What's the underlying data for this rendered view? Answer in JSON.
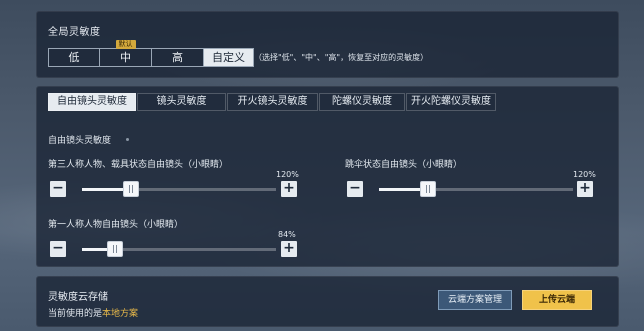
{
  "global": {
    "title": "全局灵敏度",
    "options": [
      "低",
      "中",
      "高",
      "自定义"
    ],
    "default_badge": "默认",
    "selected": "自定义",
    "hint": "（选择\"低\"、\"中\"、\"高\"，恢复至对应的灵敏度）"
  },
  "tabs": [
    "自由镜头灵敏度",
    "镜头灵敏度",
    "开火镜头灵敏度",
    "陀螺仪灵敏度",
    "开火陀螺仪灵敏度"
  ],
  "selected_tab": "自由镜头灵敏度",
  "section": {
    "title": "自由镜头灵敏度"
  },
  "sliders": [
    {
      "label": "第三人称人物、载具状态自由镜头（小眼睛）",
      "value_text": "120%",
      "level": 0.25
    },
    {
      "label": "跳伞状态自由镜头（小眼睛）",
      "value_text": "120%",
      "level": 0.25
    },
    {
      "label": "第一人称人物自由镜头（小眼睛）",
      "value_text": "84%",
      "level": 0.17
    }
  ],
  "cloud": {
    "title": "灵敏度云存储",
    "current_prefix": "当前使用的是",
    "current_value": "本地方案",
    "manage_label": "云端方案管理",
    "upload_label": "上传云端"
  },
  "colors": {
    "accent": "#f0c24a",
    "highlight_text": "#e8b94a",
    "selected_bg": "#e6ebf0"
  }
}
